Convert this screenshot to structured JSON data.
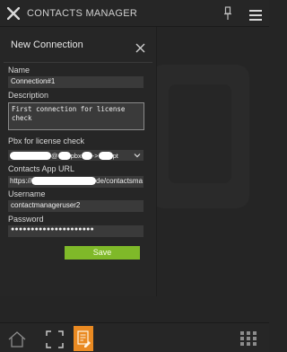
{
  "app": {
    "title": "CONTACTS MANAGER",
    "accent_color": "#7fb929",
    "logo_icon": "x-logo-icon"
  },
  "panel": {
    "title": "New Connection",
    "fields": {
      "name": {
        "label": "Name",
        "value": "Connection#1"
      },
      "description": {
        "label": "Description",
        "value": "First connection for license check"
      },
      "pbx": {
        "label": "Pbx for license check",
        "value_visible_parts": [
          "@",
          "pbx",
          "->",
          "pt"
        ]
      },
      "url": {
        "label": "Contacts App URL",
        "value_prefix": "https://",
        "value_suffix": "de/contactsma"
      },
      "username": {
        "label": "Username",
        "value": "contactmanageruser2"
      },
      "password": {
        "label": "Password",
        "value": "●●●●●●●●●●●●●●●●●●●●●"
      }
    },
    "save_label": "Save"
  },
  "bottombar": {
    "icons": [
      "home-icon",
      "fullscreen-icon",
      "contacts-app-icon",
      "app-grid-icon"
    ],
    "active_color": "#ea8a22"
  }
}
